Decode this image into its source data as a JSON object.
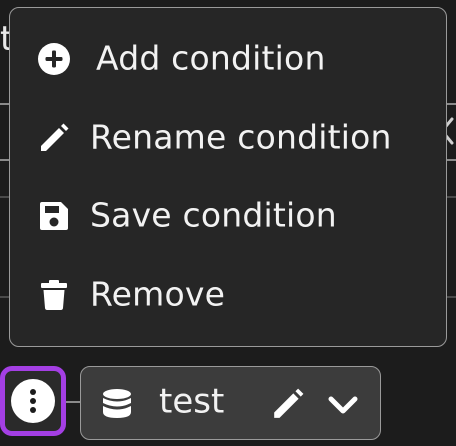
{
  "menu": {
    "items": [
      {
        "label": "Add condition",
        "icon": "plus-circle-icon"
      },
      {
        "label": "Rename condition",
        "icon": "pencil-icon"
      },
      {
        "label": "Save condition",
        "icon": "floppy-disk-icon"
      },
      {
        "label": "Remove",
        "icon": "trash-icon"
      }
    ]
  },
  "background": {
    "fragment_text": "t"
  },
  "dataset_chip": {
    "label": "test",
    "icon": "database-icon"
  },
  "colors": {
    "menu_background": "#262626",
    "menu_border": "#9a9a9a",
    "kebab_focus_ring": "#a43fe4",
    "chip_background": "#3c3c3c",
    "text": "#f2f2f2"
  }
}
